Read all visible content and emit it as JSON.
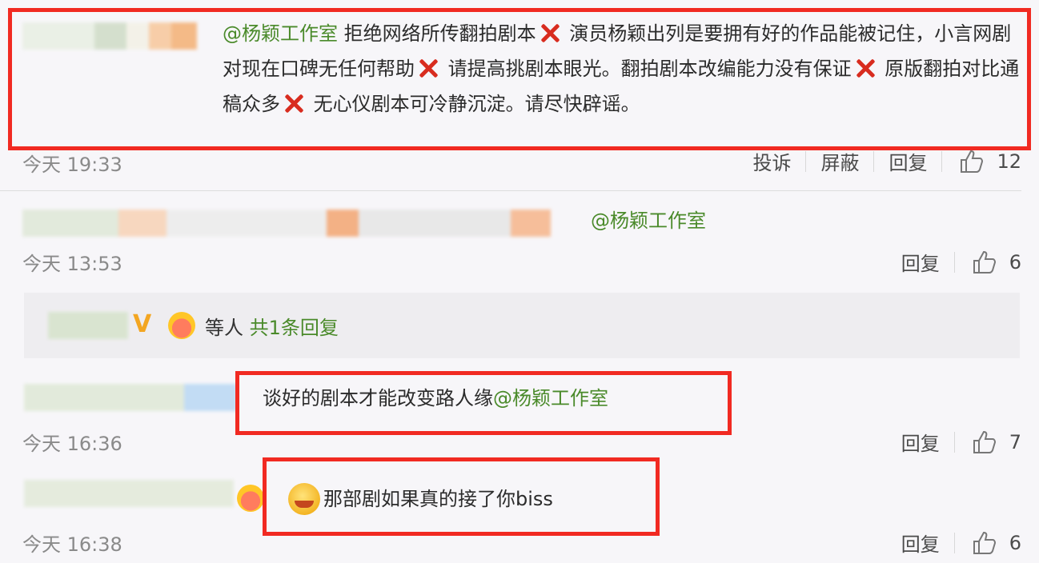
{
  "comments": [
    {
      "time": "今天 19:33",
      "text_parts": [
        {
          "t": "@杨颖工作室",
          "mention": true
        },
        {
          "t": " 拒绝网络所传翻拍剧本"
        },
        {
          "x": true
        },
        {
          "t": " 演员杨颖出列是要拥有好的作品能被记住，小言网剧对现在口碑无任何帮助"
        },
        {
          "x": true
        },
        {
          "t": " 请提高挑剧本眼光。翻拍剧本改编能力没有保证"
        },
        {
          "x": true
        },
        {
          "t": " 原版翻拍对比通稿众多"
        },
        {
          "x": true
        },
        {
          "t": " 无心仪剧本可冷静沉淀。请尽快辟谣。"
        }
      ],
      "actions": {
        "report": "投诉",
        "block": "屏蔽",
        "reply": "回复"
      },
      "likes": "12"
    },
    {
      "time": "今天 13:53",
      "mention": "@杨颖工作室",
      "actions": {
        "reply": "回复"
      },
      "likes": "6",
      "reply_summary": {
        "who": "等人",
        "count": "共1条回复"
      }
    },
    {
      "time": "今天 16:36",
      "text": "谈好的剧本才能改变路人缘",
      "mention": "@杨颖工作室",
      "actions": {
        "reply": "回复"
      },
      "likes": "7"
    },
    {
      "time": "今天 16:38",
      "text": "那部剧如果真的接了你biss",
      "actions": {
        "reply": "回复"
      },
      "likes": "6"
    }
  ],
  "icons": {
    "like": "thumbs-up-icon",
    "x": "red-x-mark-icon",
    "vip": "vip-v-badge",
    "crown": "crown-badge-icon",
    "emoji": "grin-emoji-icon"
  },
  "colors": {
    "mention": "#4a8a2a",
    "highlight_box": "#f12a22"
  }
}
